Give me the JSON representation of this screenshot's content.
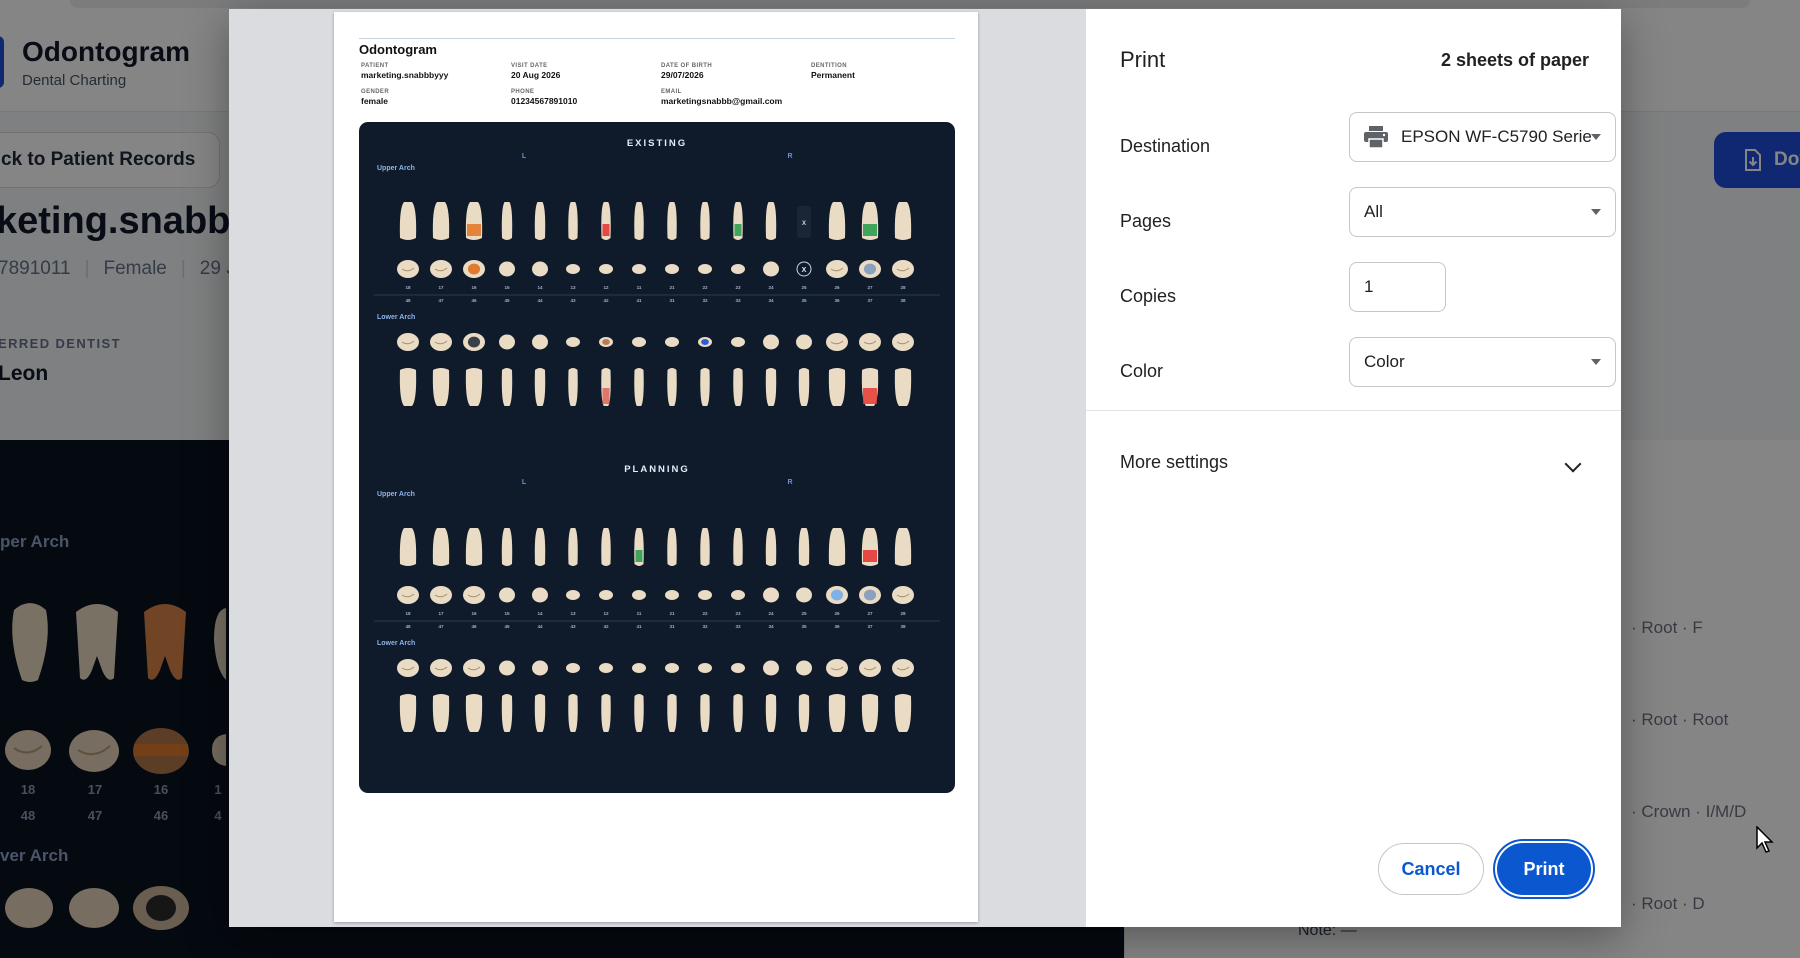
{
  "app": {
    "title": "Odontogram",
    "subtitle": "Dental Charting",
    "back_button": "ck to Patient Records",
    "patient_name": "keting.snabbby",
    "meta": [
      "7891011",
      "Female",
      "29 J"
    ],
    "referred_label": "ERRED DENTIST",
    "referred_value": "Leon",
    "download_label": "Dov",
    "upper_arch": "per Arch",
    "lower_arch": "ver Arch",
    "upper_numbers": [
      "18",
      "17",
      "16",
      "1"
    ],
    "lower_numbers": [
      "48",
      "47",
      "46",
      "4"
    ],
    "right_items": [
      "· Root · F",
      "· Root · Root",
      "· Crown · I/M/D",
      "· Root · D"
    ],
    "note": "Note: —"
  },
  "sheet": {
    "title": "Odontogram",
    "fields": [
      {
        "label": "PATIENT",
        "value": "marketing.snabbbyyy"
      },
      {
        "label": "VISIT DATE",
        "value": "20 Aug 2026"
      },
      {
        "label": "DATE OF BIRTH",
        "value": "29/07/2026"
      },
      {
        "label": "DENTITION",
        "value": "Permanent"
      },
      {
        "label": "GENDER",
        "value": "female"
      },
      {
        "label": "PHONE",
        "value": "01234567891010"
      },
      {
        "label": "EMAIL",
        "value": "marketingsnabbb@gmail.com"
      }
    ],
    "charts": [
      {
        "heading": "EXISTING",
        "upper_label": "Upper Arch",
        "lower_label": "Lower Arch",
        "side_left": "L",
        "side_right": "R"
      },
      {
        "heading": "PLANNING",
        "upper_label": "Upper Arch",
        "lower_label": "Lower Arch",
        "side_left": "L",
        "side_right": "R"
      }
    ],
    "upper_numbers": [
      "18",
      "17",
      "16",
      "15",
      "14",
      "13",
      "12",
      "11",
      "21",
      "22",
      "23",
      "24",
      "25",
      "26",
      "27",
      "28"
    ],
    "lower_numbers": [
      "48",
      "47",
      "46",
      "45",
      "44",
      "43",
      "42",
      "41",
      "31",
      "32",
      "33",
      "34",
      "35",
      "36",
      "37",
      "38"
    ],
    "missing_marker": "X"
  },
  "print": {
    "title": "Print",
    "sheets": "2 sheets of paper",
    "destination_label": "Destination",
    "destination_value": "EPSON WF-C5790 Series",
    "pages_label": "Pages",
    "pages_value": "All",
    "copies_label": "Copies",
    "copies_value": "1",
    "color_label": "Color",
    "color_value": "Color",
    "more_settings": "More settings",
    "cancel": "Cancel",
    "print": "Print"
  },
  "colors": {
    "accent": "#0b57d0",
    "chart_bg": "#0f1a2a",
    "tooth": "#eadbc4",
    "caries_orange": "#e2792e",
    "treat_red": "#e53935",
    "treat_green": "#2e9e4f",
    "treat_blue": "#2f5bd6"
  }
}
